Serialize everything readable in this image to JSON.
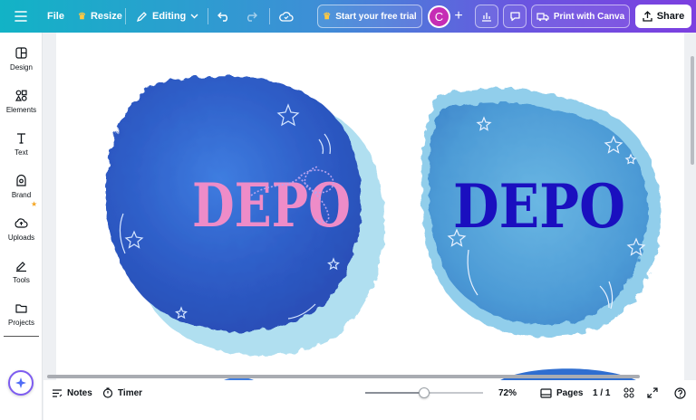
{
  "topbar": {
    "file": "File",
    "resize": "Resize",
    "editing": "Editing",
    "trial": "Start your free trial",
    "avatar_initial": "C",
    "print": "Print with Canva",
    "share": "Share"
  },
  "sidebar": {
    "items": [
      {
        "label": "Design",
        "icon": "design-icon"
      },
      {
        "label": "Elements",
        "icon": "elements-icon"
      },
      {
        "label": "Text",
        "icon": "text-icon"
      },
      {
        "label": "Brand",
        "icon": "brand-icon"
      },
      {
        "label": "Uploads",
        "icon": "uploads-icon"
      },
      {
        "label": "Tools",
        "icon": "tools-icon"
      },
      {
        "label": "Projects",
        "icon": "projects-icon"
      }
    ]
  },
  "canvas": {
    "logo_left": {
      "text": "DEPO",
      "text_color": "#ee8cc8",
      "blob_color": "#2f63c9"
    },
    "logo_right": {
      "text": "DEPO",
      "text_color": "#1a0fbf",
      "blob_color": "#5aa8dc"
    }
  },
  "bottombar": {
    "notes": "Notes",
    "timer": "Timer",
    "zoom_value": 0.5,
    "zoom": "72%",
    "pages": "Pages",
    "page_count": "1 / 1"
  },
  "colors": {
    "accent": "#7d5cf0",
    "avatar": "#c62db5"
  }
}
